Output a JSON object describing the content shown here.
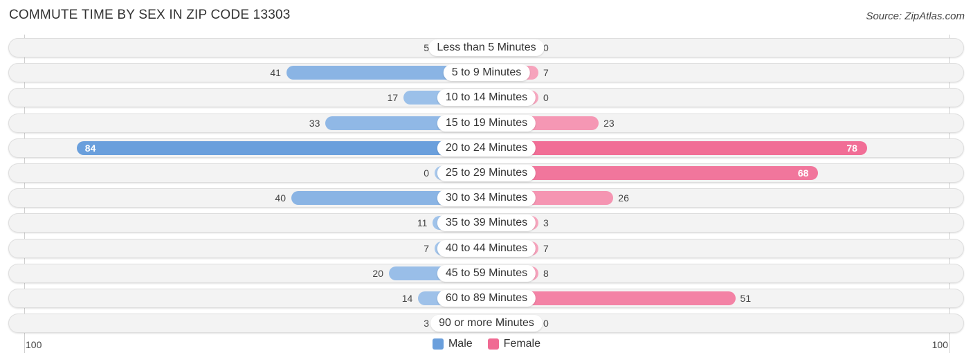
{
  "header": {
    "title": "COMMUTE TIME BY SEX IN ZIP CODE 13303",
    "source": "Source: ZipAtlas.com"
  },
  "colors": {
    "male_strong": "#6a9fdc",
    "male_light": "#a8c8ec",
    "female_strong": "#f06a93",
    "female_light": "#f7a8c0"
  },
  "chart_data": {
    "type": "bar",
    "orientation": "horizontal-diverging",
    "title": "COMMUTE TIME BY SEX IN ZIP CODE 13303",
    "categories": [
      "Less than 5 Minutes",
      "5 to 9 Minutes",
      "10 to 14 Minutes",
      "15 to 19 Minutes",
      "20 to 24 Minutes",
      "25 to 29 Minutes",
      "30 to 34 Minutes",
      "35 to 39 Minutes",
      "40 to 44 Minutes",
      "45 to 59 Minutes",
      "60 to 89 Minutes",
      "90 or more Minutes"
    ],
    "series": [
      {
        "name": "Male",
        "values": [
          5,
          41,
          17,
          33,
          84,
          0,
          40,
          11,
          7,
          20,
          14,
          3
        ]
      },
      {
        "name": "Female",
        "values": [
          0,
          7,
          0,
          23,
          78,
          68,
          26,
          3,
          7,
          8,
          51,
          0
        ]
      }
    ],
    "axis": {
      "left_label": "100",
      "right_label": "100",
      "range": [
        -100,
        100
      ]
    },
    "legend": {
      "position": "bottom-center",
      "entries": [
        "Male",
        "Female"
      ]
    },
    "grid": false
  }
}
